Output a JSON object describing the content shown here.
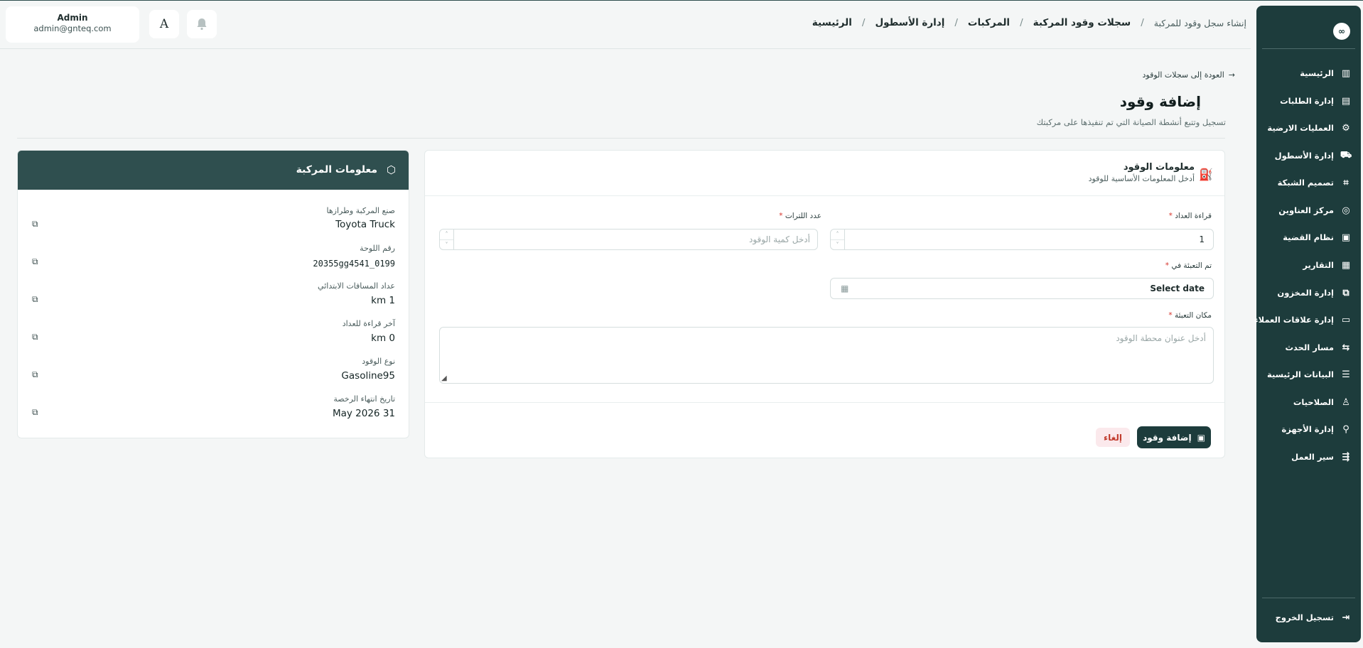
{
  "header": {
    "user_name": "Admin",
    "user_email": "admin@gnteq.com",
    "language_button": "A",
    "breadcrumbs": [
      "الرئيسية",
      "إدارة الأسطول",
      "المركبات",
      "سجلات وقود المركبة",
      "إنشاء سجل وقود للمركبة"
    ]
  },
  "sidebar": {
    "logo": "∞",
    "items": [
      {
        "label": "الرئيسية",
        "icon": "dashboard-icon"
      },
      {
        "label": "إدارة الطلبات",
        "icon": "orders-icon"
      },
      {
        "label": "العمليات الارضية",
        "icon": "ground-ops-icon"
      },
      {
        "label": "إدارة الأسطول",
        "icon": "truck-icon"
      },
      {
        "label": "تصميم الشبكة",
        "icon": "network-icon"
      },
      {
        "label": "مركز العناوين",
        "icon": "map-pin-icon"
      },
      {
        "label": "نظام القضية",
        "icon": "case-icon"
      },
      {
        "label": "التقارير",
        "icon": "reports-icon"
      },
      {
        "label": "إدارة المخزون",
        "icon": "inventory-icon"
      },
      {
        "label": "إدارة علاقات العملاء",
        "icon": "crm-icon"
      },
      {
        "label": "مسار الحدث",
        "icon": "event-path-icon"
      },
      {
        "label": "البيانات الرئيسية",
        "icon": "database-icon"
      },
      {
        "label": "الصلاحيات",
        "icon": "users-icon"
      },
      {
        "label": "إدارة الأجهزة",
        "icon": "devices-icon"
      },
      {
        "label": "سير العمل",
        "icon": "workflow-icon"
      }
    ],
    "logout_label": "تسجيل الخروج"
  },
  "page": {
    "back_link": "العودة إلى سجلات الوقود",
    "title": "إضافة وقود",
    "subtitle": "تسجيل وتتبع أنشطة الصيانة التي تم تنفيذها على مركبتك"
  },
  "fuel_form": {
    "title": "معلومات الوقود",
    "subtitle": "أدخل المعلومات الأساسية للوقود",
    "odometer_label": "قراءة العداد",
    "odometer_value": "1",
    "liters_label": "عدد اللترات",
    "liters_placeholder": "أدخل كمية الوقود",
    "filled_at_label": "تم التعبئة في",
    "filled_at_value": "Select date",
    "location_label": "مكان التعبئة",
    "location_placeholder": "أدخل عنوان محطة الوقود",
    "required_mark": "*",
    "submit_label": "إضافة وقود",
    "cancel_label": "إلغاء"
  },
  "vehicle_info": {
    "title": "معلومات المركبة",
    "rows": [
      {
        "label": "صنع المركبة وطرازها",
        "value": "Toyota Truck"
      },
      {
        "label": "رقم اللوحة",
        "value": "20355gg4541_0199"
      },
      {
        "label": "عداد المسافات الابتدائي",
        "value": "km 1"
      },
      {
        "label": "آخر قراءة للعداد",
        "value": "km 0"
      },
      {
        "label": "نوع الوقود",
        "value": "Gasoline95"
      },
      {
        "label": "تاريخ انتهاء الرخصة",
        "value": "May 2026 31"
      }
    ]
  }
}
